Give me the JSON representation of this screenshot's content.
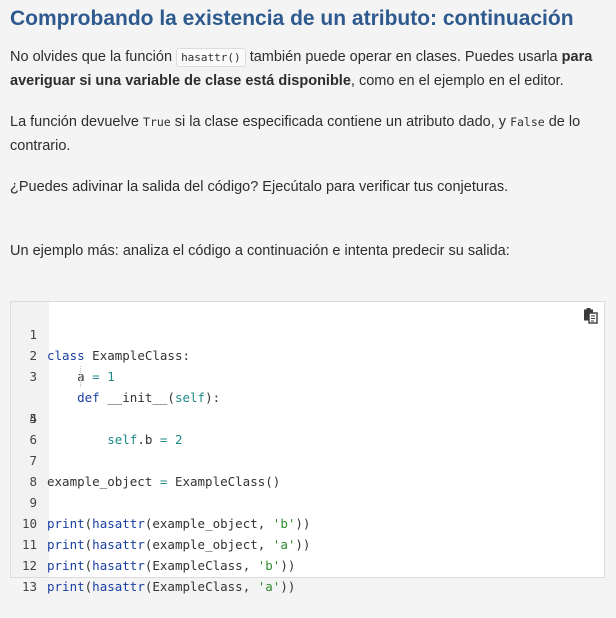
{
  "heading": "Comprobando la existencia de un atributo: continuación",
  "paragraph1": {
    "text_before_code": "No olvides que la función ",
    "code": "hasattr()",
    "text_after_code": " también puede operar en clases. Puedes usarla ",
    "bold": "para averiguar si una variable de clase está disponible",
    "text_end": ", como en el ejemplo en el editor."
  },
  "paragraph2": {
    "text_a": "La función devuelve ",
    "code_a": "True",
    "text_b": " si la clase especificada contiene un atributo dado, y ",
    "code_b": "False",
    "text_c": " de lo contrario."
  },
  "paragraph3": "¿Puedes adivinar la salida del código? Ejecútalo para verificar tus conjeturas.",
  "paragraph4": "Un ejemplo más: analiza el código a continuación e intenta predecir su salida:",
  "editor": {
    "copy_icon": "copy-icon",
    "line_numbers": [
      "1",
      "2",
      "3",
      "4",
      "5",
      "6",
      "7",
      "8",
      "9",
      "10",
      "11",
      "12",
      "13"
    ],
    "code": {
      "l1_kw": "class",
      "l1_rest": " ExampleClass:",
      "l2_indent": "    ",
      "l2_name": "a ",
      "l2_op": "=",
      "l2_space": " ",
      "l2_num": "1",
      "l3_indent": "    ",
      "l3_kw": "def",
      "l3_name": " __init__(",
      "l3_self": "self",
      "l3_end": "):",
      "l4_indent": "        ",
      "l4_self": "self",
      "l4_attr": ".b ",
      "l4_op": "=",
      "l4_space": " ",
      "l4_num": "2",
      "l7_name": "example_object ",
      "l7_op": "=",
      "l7_rest": " ExampleClass()",
      "l9_fn": "print",
      "l9_p1": "(",
      "l9_fn2": "hasattr",
      "l9_args": "(example_object, ",
      "l9_str": "'b'",
      "l9_end": "))",
      "l10_fn": "print",
      "l10_p1": "(",
      "l10_fn2": "hasattr",
      "l10_args": "(example_object, ",
      "l10_str": "'a'",
      "l10_end": "))",
      "l11_fn": "print",
      "l11_p1": "(",
      "l11_fn2": "hasattr",
      "l11_args": "(ExampleClass, ",
      "l11_str": "'b'",
      "l11_end": "))",
      "l12_fn": "print",
      "l12_p1": "(",
      "l12_fn2": "hasattr",
      "l12_args": "(ExampleClass, ",
      "l12_str": "'a'",
      "l12_end": "))"
    }
  }
}
